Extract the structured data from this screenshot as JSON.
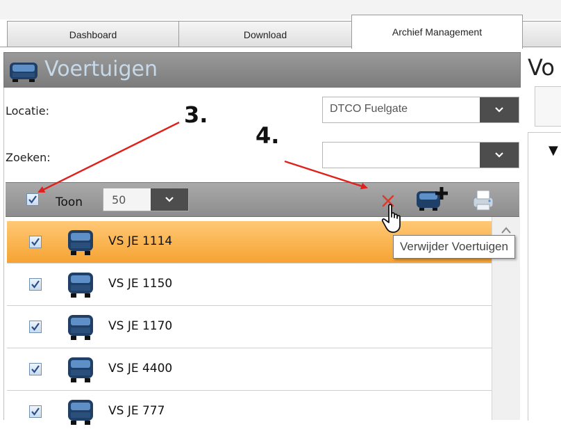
{
  "tabs": [
    {
      "label": "Dashboard"
    },
    {
      "label": "Download"
    },
    {
      "label": "Archief Management",
      "active": true
    }
  ],
  "panel": {
    "title": "Voertuigen",
    "title_icon": "truck-icon",
    "locatie_label": "Locatie:",
    "locatie_value": "DTCO Fuelgate",
    "zoeken_label": "Zoeken:",
    "zoeken_value": ""
  },
  "toolbar": {
    "select_all_checked": true,
    "toon_label": "Toon",
    "toon_value": "50",
    "actions": [
      {
        "icon": "delete-x-icon",
        "tooltip": "Verwijder Voertuigen"
      },
      {
        "icon": "add-truck-icon"
      },
      {
        "icon": "printer-icon"
      }
    ]
  },
  "vehicles": [
    {
      "name": "VS JE 1114",
      "checked": true,
      "selected": true
    },
    {
      "name": "VS JE 1150",
      "checked": true,
      "selected": false
    },
    {
      "name": "VS JE 1170",
      "checked": true,
      "selected": false
    },
    {
      "name": "VS JE 4400",
      "checked": true,
      "selected": false
    },
    {
      "name": "VS JE 777",
      "checked": true,
      "selected": false
    }
  ],
  "right_pane": {
    "title": "Vo"
  },
  "tooltip": "Verwijder Voertuigen",
  "annotations": {
    "step3": "3.",
    "step4": "4."
  },
  "colors": {
    "selected_row": "#f5a332",
    "arrow": "#e0201c",
    "header_bar": "#8a8a8a",
    "dropdown_button": "#4d4d4d"
  }
}
